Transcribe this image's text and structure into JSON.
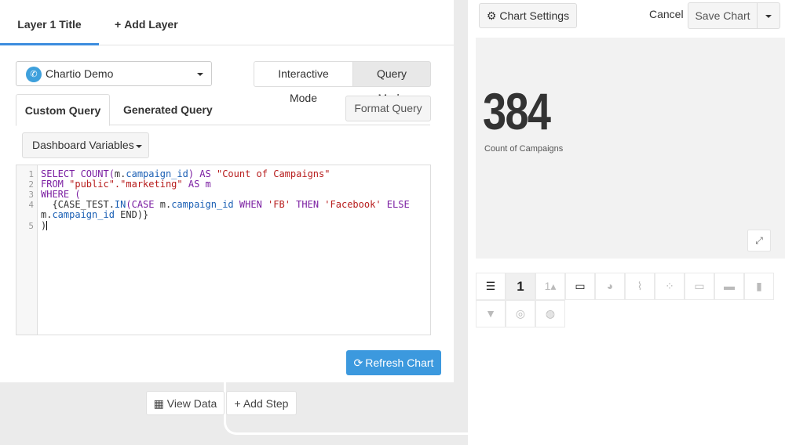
{
  "layer_tabs": {
    "active_label": "Layer 1 Title",
    "add_label": "Add Layer"
  },
  "datasource": {
    "icon_text": "✆",
    "label": "Chartio Demo"
  },
  "modes": {
    "interactive": "Interactive Mode",
    "query": "Query Mode",
    "selected": "Query Mode"
  },
  "query_tabs": {
    "custom": "Custom Query",
    "generated": "Generated Query",
    "format": "Format Query"
  },
  "dashboard_variables": "Dashboard Variables",
  "editor": {
    "line_numbers": [
      "1",
      "2",
      "3",
      "4",
      "5"
    ],
    "lines": [
      [
        "SELECT COUNT(",
        "m.",
        "campaign_id",
        ") AS ",
        "\"Count of Campaigns\""
      ],
      [
        "FROM ",
        "\"public\".\"marketing\"",
        " AS m"
      ],
      [
        "WHERE ("
      ],
      [
        "  {CASE_TEST.",
        "IN",
        "(CASE ",
        "m.",
        "campaign_id",
        " WHEN ",
        "'FB'",
        " THEN ",
        "'Facebook'",
        " ELSE"
      ],
      [
        "m.",
        "campaign_id",
        " END)}"
      ],
      [
        ")"
      ]
    ]
  },
  "refresh_label": "Refresh Chart",
  "pipeline": {
    "view_data": "View Data",
    "add_step": "Add Step"
  },
  "right_header": {
    "chart_settings": "Chart Settings",
    "cancel": "Cancel",
    "save": "Save Chart"
  },
  "preview": {
    "value": "384",
    "label": "Count of Campaigns"
  },
  "chart_type_icons": [
    {
      "name": "table",
      "glyph": "☰",
      "selected": false,
      "dark": true
    },
    {
      "name": "single-value",
      "glyph": "1",
      "selected": true,
      "dark": true
    },
    {
      "name": "single-value-trend",
      "glyph": "1▴",
      "selected": false,
      "dark": false
    },
    {
      "name": "progress",
      "glyph": "▭",
      "selected": false,
      "dark": true
    },
    {
      "name": "pie",
      "glyph": "◕",
      "selected": false,
      "dark": false
    },
    {
      "name": "line",
      "glyph": "⌇",
      "selected": false,
      "dark": false
    },
    {
      "name": "scatter",
      "glyph": "⁘",
      "selected": false,
      "dark": false
    },
    {
      "name": "area",
      "glyph": "▭",
      "selected": false,
      "dark": false
    },
    {
      "name": "area-filled",
      "glyph": "▬",
      "selected": false,
      "dark": false
    },
    {
      "name": "bar",
      "glyph": "▮",
      "selected": false,
      "dark": false
    },
    {
      "name": "funnel",
      "glyph": "▼",
      "selected": false,
      "dark": false
    },
    {
      "name": "globe",
      "glyph": "◎",
      "selected": false,
      "dark": false
    },
    {
      "name": "map",
      "glyph": "◍",
      "selected": false,
      "dark": false
    }
  ],
  "colors": {
    "accent": "#3c99de",
    "tab_underline": "#3c8dde",
    "keyword": "#7b1fa2",
    "string": "#b71c1c",
    "field": "#1a5fb4"
  }
}
